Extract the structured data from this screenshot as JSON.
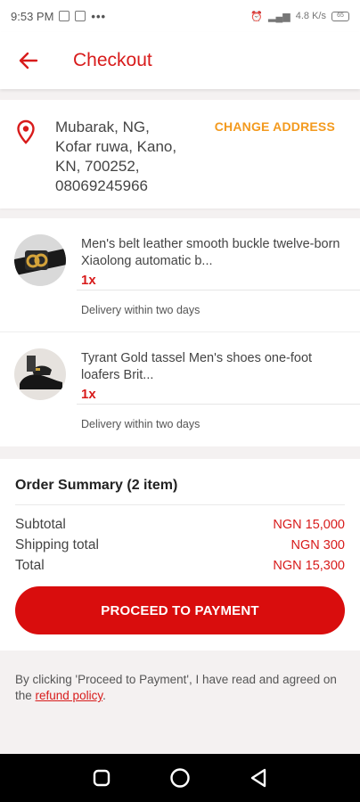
{
  "status_bar": {
    "time": "9:53 PM",
    "speed": "4.8 K/s",
    "battery": "65"
  },
  "header": {
    "title": "Checkout"
  },
  "address": {
    "line1": "Mubarak, NG,",
    "line2": "Kofar ruwa, Kano,",
    "line3": "KN, 700252,",
    "line4": "08069245966",
    "change_label": "CHANGE ADDRESS"
  },
  "items": [
    {
      "name": "Men's belt leather smooth buckle twelve-born Xiaolong automatic b...",
      "qty": "1x",
      "delivery": "Delivery within two days"
    },
    {
      "name": "Tyrant Gold tassel Men's shoes one-foot loafers Brit...",
      "qty": "1x",
      "delivery": "Delivery within two days"
    }
  ],
  "summary": {
    "title": "Order Summary (2 item)",
    "rows": [
      {
        "label": "Subtotal",
        "value": "NGN 15,000"
      },
      {
        "label": "Shipping total",
        "value": "NGN 300"
      },
      {
        "label": "Total",
        "value": "NGN 15,300"
      }
    ],
    "pay_button": "PROCEED TO PAYMENT"
  },
  "agreement": {
    "text": "By clicking 'Proceed to Payment', I have read and agreed on the ",
    "link": "refund policy",
    "end": "."
  },
  "colors": {
    "accent": "#d81b1b",
    "button": "#d90d0d",
    "change_address": "#f39a1e"
  },
  "icons": [
    "back-arrow-icon",
    "location-pin-icon",
    "square-nav-icon",
    "circle-nav-icon",
    "triangle-back-nav-icon"
  ]
}
